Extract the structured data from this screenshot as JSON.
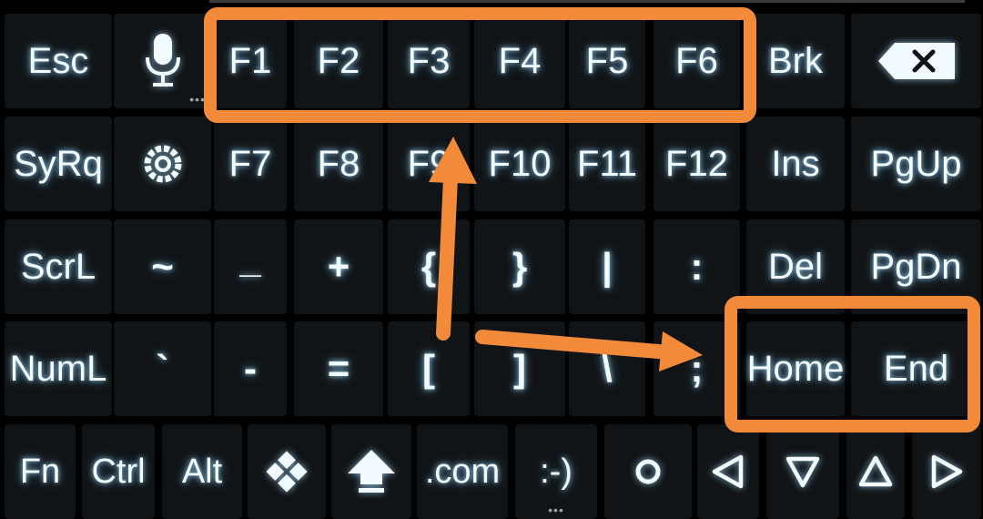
{
  "keyboard": {
    "rows": [
      [
        {
          "label": "Esc",
          "name": "key-esc"
        },
        {
          "label": "",
          "name": "key-microphone",
          "icon": "microphone-icon"
        },
        {
          "label": "F1",
          "name": "key-f1"
        },
        {
          "label": "F2",
          "name": "key-f2"
        },
        {
          "label": "F3",
          "name": "key-f3"
        },
        {
          "label": "F4",
          "name": "key-f4"
        },
        {
          "label": "F5",
          "name": "key-f5"
        },
        {
          "label": "F6",
          "name": "key-f6"
        },
        {
          "label": "Brk",
          "name": "key-brk"
        },
        {
          "label": "",
          "name": "key-backspace",
          "icon": "backspace-icon"
        }
      ],
      [
        {
          "label": "SyRq",
          "name": "key-syrq"
        },
        {
          "label": "",
          "name": "key-settings",
          "icon": "settings-icon"
        },
        {
          "label": "F7",
          "name": "key-f7"
        },
        {
          "label": "F8",
          "name": "key-f8"
        },
        {
          "label": "F9",
          "name": "key-f9"
        },
        {
          "label": "F10",
          "name": "key-f10"
        },
        {
          "label": "F11",
          "name": "key-f11"
        },
        {
          "label": "F12",
          "name": "key-f12"
        },
        {
          "label": "Ins",
          "name": "key-ins"
        },
        {
          "label": "PgUp",
          "name": "key-pgup"
        }
      ],
      [
        {
          "label": "ScrL",
          "name": "key-scrl"
        },
        {
          "label": "~",
          "name": "key-tilde"
        },
        {
          "label": "_",
          "name": "key-underscore"
        },
        {
          "label": "+",
          "name": "key-plus"
        },
        {
          "label": "{",
          "name": "key-left-brace"
        },
        {
          "label": "}",
          "name": "key-right-brace"
        },
        {
          "label": "|",
          "name": "key-pipe"
        },
        {
          "label": ":",
          "name": "key-colon"
        },
        {
          "label": "Del",
          "name": "key-del"
        },
        {
          "label": "PgDn",
          "name": "key-pgdn"
        }
      ],
      [
        {
          "label": "NumL",
          "name": "key-numl"
        },
        {
          "label": "`",
          "name": "key-backtick"
        },
        {
          "label": "-",
          "name": "key-minus"
        },
        {
          "label": "=",
          "name": "key-equals"
        },
        {
          "label": "[",
          "name": "key-left-bracket"
        },
        {
          "label": "]",
          "name": "key-right-bracket"
        },
        {
          "label": "\\",
          "name": "key-backslash"
        },
        {
          "label": ";",
          "name": "key-semicolon"
        },
        {
          "label": "Home",
          "name": "key-home"
        },
        {
          "label": "End",
          "name": "key-end"
        }
      ],
      [
        {
          "label": "Fn",
          "name": "key-fn"
        },
        {
          "label": "Ctrl",
          "name": "key-ctrl"
        },
        {
          "label": "Alt",
          "name": "key-alt"
        },
        {
          "label": "",
          "name": "key-windows",
          "icon": "windows-icon"
        },
        {
          "label": "",
          "name": "key-shift",
          "icon": "shift-arrow-icon"
        },
        {
          "label": ".com",
          "name": "key-dotcom"
        },
        {
          "label": ":-)",
          "name": "key-smiley"
        },
        {
          "label": "",
          "name": "key-circle",
          "icon": "circle-icon"
        },
        {
          "label": "",
          "name": "key-arrow-left",
          "icon": "triangle-left-icon"
        },
        {
          "label": "",
          "name": "key-arrow-down",
          "icon": "triangle-down-icon"
        },
        {
          "label": "",
          "name": "key-arrow-up",
          "icon": "triangle-up-icon"
        },
        {
          "label": "",
          "name": "key-arrow-right",
          "icon": "triangle-right-icon"
        }
      ]
    ]
  },
  "annotations": {
    "highlight_color": "#f28a3a",
    "boxes": [
      "f1-f6-group",
      "home-end-group"
    ],
    "arrows": [
      "arrow-to-f1-f6",
      "arrow-to-home-end"
    ]
  }
}
